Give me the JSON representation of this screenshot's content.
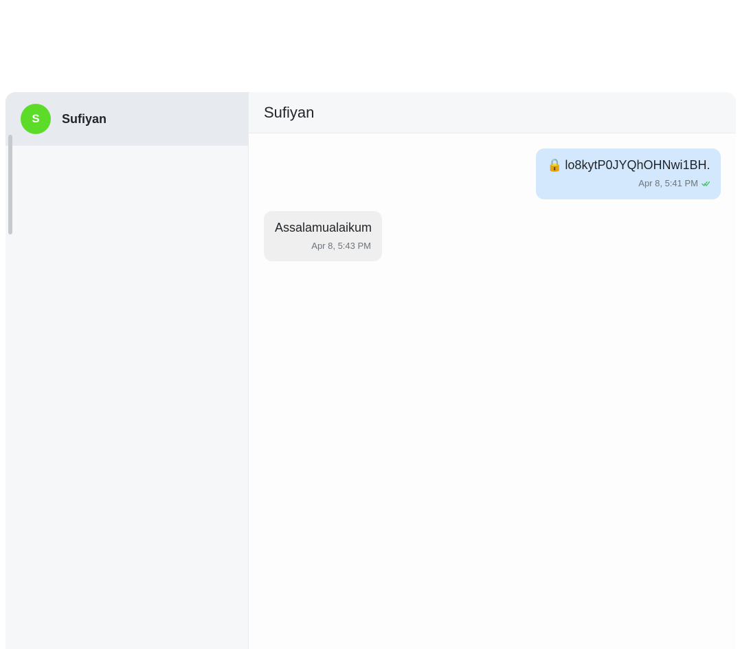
{
  "sidebar": {
    "contacts": [
      {
        "initial": "S",
        "name": "Sufiyan",
        "avatar_color": "#5cdb28"
      }
    ]
  },
  "chat": {
    "title": "Sufiyan",
    "messages": [
      {
        "direction": "sent",
        "icon": "lock-icon",
        "text": "lo8kytP0JYQhOHNwi1BH...",
        "time": "Apr 8, 5:41 PM",
        "status_icon": "double-check-icon"
      },
      {
        "direction": "received",
        "text": "Assalamualaikum",
        "time": "Apr 8, 5:43 PM"
      }
    ]
  },
  "colors": {
    "sent_bubble": "#d3e7fd",
    "received_bubble": "#efefef",
    "read_check": "#3cc45a"
  }
}
